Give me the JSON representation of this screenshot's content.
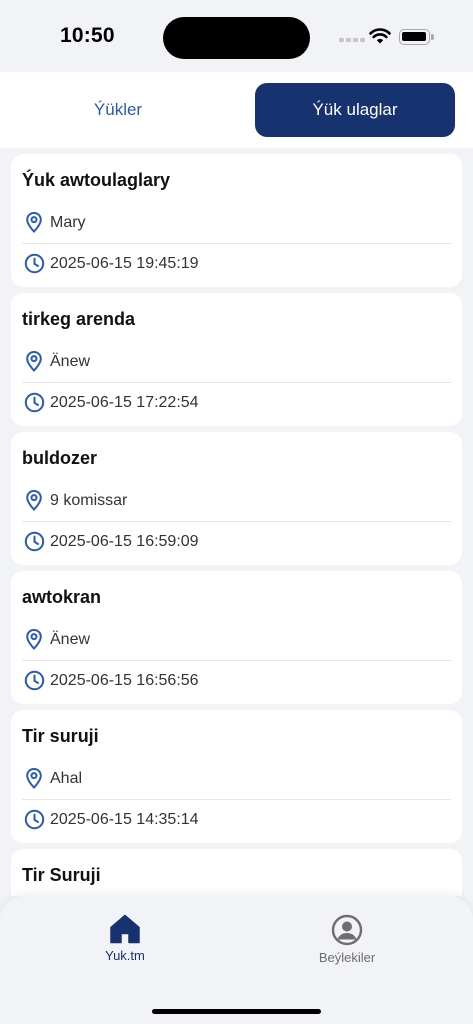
{
  "status_bar": {
    "time": "10:50"
  },
  "tabs": [
    {
      "label": "Ýükler",
      "active": false
    },
    {
      "label": "Ýük ulaglar",
      "active": true
    }
  ],
  "colors": {
    "accent": "#17336f",
    "link": "#2a5ab4",
    "icon": "#2a5ab4",
    "background": "#f2f3f7"
  },
  "cards": [
    {
      "title": "Ýuk awtoulaglary",
      "location": "Mary",
      "datetime": "2025-06-15 19:45:19"
    },
    {
      "title": "tirkeg arenda",
      "location": "Änew",
      "datetime": "2025-06-15 17:22:54"
    },
    {
      "title": "buldozer",
      "location": "9 komissar",
      "datetime": "2025-06-15 16:59:09"
    },
    {
      "title": "awtokran",
      "location": "Änew",
      "datetime": "2025-06-15 16:56:56"
    },
    {
      "title": "Tir suruji",
      "location": "Ahal",
      "datetime": "2025-06-15 14:35:14"
    },
    {
      "title": "Tir Suruji"
    }
  ],
  "bottom_nav": [
    {
      "label": "Yuk.tm",
      "icon": "home-icon",
      "active": true
    },
    {
      "label": "Beýlekiler",
      "icon": "profile-icon",
      "active": false
    }
  ]
}
